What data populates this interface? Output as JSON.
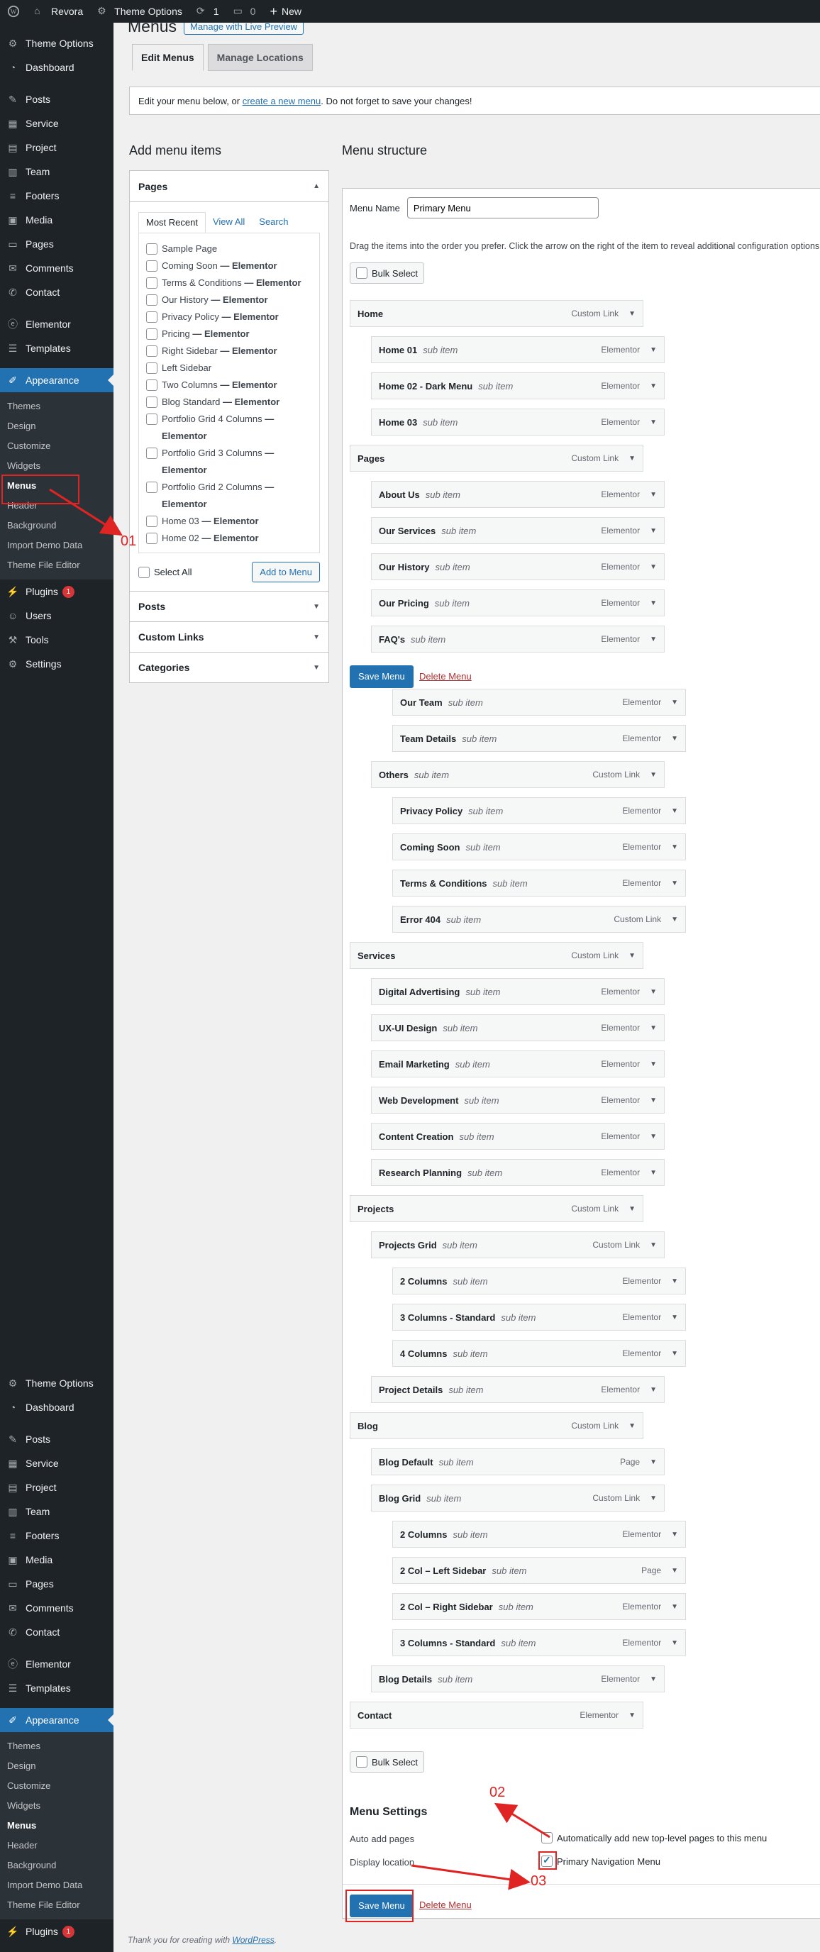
{
  "adminbar": {
    "site": "Revora",
    "theme_options": "Theme Options",
    "updates": "1",
    "comments": "0",
    "new": "New"
  },
  "sidebar": {
    "group1": [
      "Theme Options",
      "Dashboard"
    ],
    "group2": [
      "Posts",
      "Service",
      "Project",
      "Team",
      "Footers",
      "Media",
      "Pages",
      "Comments",
      "Contact"
    ],
    "group3": [
      "Elementor",
      "Templates"
    ],
    "appearance": "Appearance",
    "submenu": [
      "Themes",
      "Design",
      "Customize",
      "Widgets",
      "Menus",
      "Header",
      "Background",
      "Import Demo Data",
      "Theme File Editor"
    ],
    "plugins": "Plugins",
    "plugins_badge": "1",
    "users": "Users",
    "tools": "Tools",
    "settings": "Settings"
  },
  "page": {
    "title": "Menus",
    "live_preview": "Manage with Live Preview",
    "tab_edit": "Edit Menus",
    "tab_locations": "Manage Locations",
    "notice_pre": "Edit your menu below, or ",
    "notice_link": "create a new menu",
    "notice_post": ". Do not forget to save your changes!",
    "footer_pre": "Thank you for creating with ",
    "footer_link": "WordPress",
    "footer_post": "."
  },
  "add_items": {
    "heading": "Add menu items",
    "pages_title": "Pages",
    "tab_recent": "Most Recent",
    "tab_all": "View All",
    "tab_search": "Search",
    "pages": [
      [
        "Sample Page",
        ""
      ],
      [
        "Coming Soon",
        " — Elementor"
      ],
      [
        "Terms & Conditions",
        " — Elementor"
      ],
      [
        "Our History",
        " — Elementor"
      ],
      [
        "Privacy Policy",
        " — Elementor"
      ],
      [
        "Pricing",
        " — Elementor"
      ],
      [
        "Right Sidebar",
        " — Elementor"
      ],
      [
        "Left Sidebar",
        ""
      ],
      [
        "Two Columns",
        " — Elementor"
      ],
      [
        "Blog Standard",
        " — Elementor"
      ],
      [
        "Portfolio Grid 4 Columns",
        " — Elementor"
      ],
      [
        "Portfolio Grid 3 Columns",
        " — Elementor"
      ],
      [
        "Portfolio Grid 2 Columns",
        " — Elementor"
      ],
      [
        "Home 03",
        " — Elementor"
      ],
      [
        "Home 02",
        " — Elementor"
      ]
    ],
    "select_all": "Select All",
    "add_btn": "Add to Menu",
    "posts": "Posts",
    "custom_links": "Custom Links",
    "categories": "Categories"
  },
  "structure": {
    "heading": "Menu structure",
    "name_label": "Menu Name",
    "name_value": "Primary Menu",
    "instructions": "Drag the items into the order you prefer. Click the arrow on the right of the item to reveal additional configuration options.",
    "bulk_select": "Bulk Select",
    "save": "Save Menu",
    "delete": "Delete Menu",
    "sub_item": "sub item",
    "items": [
      [
        "Home",
        "Custom Link",
        0
      ],
      [
        "Home 01",
        "Elementor",
        1
      ],
      [
        "Home 02 - Dark Menu",
        "Elementor",
        1
      ],
      [
        "Home 03",
        "Elementor",
        1
      ],
      [
        "Pages",
        "Custom Link",
        0
      ],
      [
        "About Us",
        "Elementor",
        1
      ],
      [
        "Our Services",
        "Elementor",
        1
      ],
      [
        "Our History",
        "Elementor",
        1
      ],
      [
        "Our Pricing",
        "Elementor",
        1
      ],
      [
        "FAQ's",
        "Elementor",
        1
      ],
      [
        "Our Team",
        "Elementor",
        2
      ],
      [
        "Team Details",
        "Elementor",
        2
      ],
      [
        "Others",
        "Custom Link",
        1
      ],
      [
        "Privacy Policy",
        "Elementor",
        2
      ],
      [
        "Coming Soon",
        "Elementor",
        2
      ],
      [
        "Terms & Conditions",
        "Elementor",
        2
      ],
      [
        "Error 404",
        "Custom Link",
        2
      ],
      [
        "Services",
        "Custom Link",
        0
      ],
      [
        "Digital Advertising",
        "Elementor",
        1
      ],
      [
        "UX-UI Design",
        "Elementor",
        1
      ],
      [
        "Email Marketing",
        "Elementor",
        1
      ],
      [
        "Web Development",
        "Elementor",
        1
      ],
      [
        "Content Creation",
        "Elementor",
        1
      ],
      [
        "Research Planning",
        "Elementor",
        1
      ],
      [
        "Projects",
        "Custom Link",
        0
      ],
      [
        "Projects Grid",
        "Custom Link",
        1
      ],
      [
        "2 Columns",
        "Elementor",
        2
      ],
      [
        "3 Columns - Standard",
        "Elementor",
        2
      ],
      [
        "4 Columns",
        "Elementor",
        2
      ],
      [
        "Project Details",
        "Elementor",
        1
      ],
      [
        "Blog",
        "Custom Link",
        0
      ],
      [
        "Blog Default",
        "Page",
        1
      ],
      [
        "Blog Grid",
        "Custom Link",
        1
      ],
      [
        "2 Columns",
        "Elementor",
        2
      ],
      [
        "2 Col – Left Sidebar",
        "Page",
        2
      ],
      [
        "2 Col – Right Sidebar",
        "Elementor",
        2
      ],
      [
        "3 Columns - Standard",
        "Elementor",
        2
      ],
      [
        "Blog Details",
        "Elementor",
        1
      ],
      [
        "Contact",
        "Elementor",
        0
      ]
    ]
  },
  "settings": {
    "heading": "Menu Settings",
    "auto_add_label": "Auto add pages",
    "auto_add_text": "Automatically add new top-level pages to this menu",
    "display_label": "Display location",
    "display_text": "Primary Navigation Menu"
  },
  "annotations": {
    "a1": "01",
    "a2": "02",
    "a3": "03"
  },
  "colors": {
    "sidebar": "#1d2327",
    "accent": "#2271b1",
    "annotation": "#e02424"
  }
}
